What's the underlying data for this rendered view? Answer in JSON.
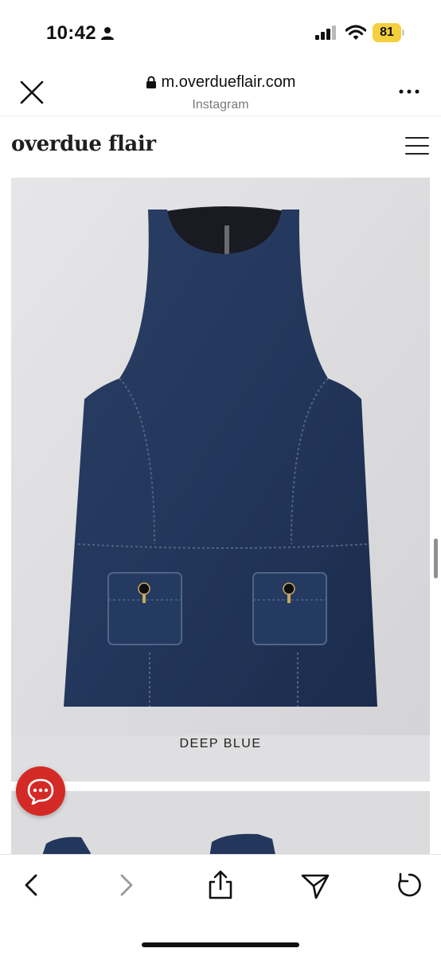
{
  "status_bar": {
    "time": "10:42",
    "battery": "81",
    "battery_color": "#f4d03f",
    "icons": [
      "person-icon",
      "signal-icon",
      "wifi-icon",
      "battery-icon"
    ]
  },
  "browser": {
    "url": "m.overdueflair.com",
    "subtitle": "Instagram",
    "icons": [
      "close-icon",
      "lock-icon",
      "more-icon"
    ]
  },
  "site": {
    "logo": "overdue flair",
    "icons": [
      "hamburger-menu-icon"
    ]
  },
  "products": [
    {
      "color_label": "DEEP BLUE",
      "image": "denim-sleeveless-mini-dress"
    },
    {
      "image": "denim-dress-partial"
    }
  ],
  "chat": {
    "icon": "chat-icon",
    "color": "#d42a26"
  },
  "toolbar": {
    "icons": [
      "back-icon",
      "forward-icon",
      "share-icon",
      "send-icon",
      "refresh-icon"
    ]
  }
}
